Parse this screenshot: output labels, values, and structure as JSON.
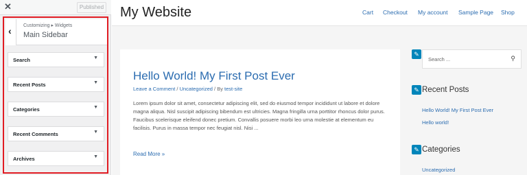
{
  "customizer": {
    "close_glyph": "✕",
    "publish_label": "Published",
    "back_glyph": "‹",
    "breadcrumb": "Customizing ▸ Widgets",
    "panel_title": "Main Sidebar",
    "caret_glyph": "▼",
    "widgets": [
      {
        "label": "Search"
      },
      {
        "label": "Recent Posts"
      },
      {
        "label": "Categories"
      },
      {
        "label": "Recent Comments"
      },
      {
        "label": "Archives"
      }
    ]
  },
  "site": {
    "title": "My Website",
    "nav": [
      "Cart",
      "Checkout",
      "My account",
      "Sample Page",
      "Shop"
    ],
    "post": {
      "title": "Hello World! My First Post Ever",
      "meta_comment": "Leave a Comment",
      "meta_sep1": " / ",
      "meta_category": "Uncategorized",
      "meta_sep2": " / By ",
      "meta_author": "test-site",
      "body": "Lorem ipsum dolor sit amet, consectetur adipiscing elit, sed do eiusmod tempor incididunt ut labore et dolore magna aliqua. Nisl suscipit adipiscing bibendum est ultricies. Magna fringilla urna porttitor rhoncus dolor purus. Faucibus scelerisque eleifend donec pretium. Convallis posuere morbi leo urna molestie at elementum eu facilisis. Purus in massa tempor nec feugiat nisl. Nisi ...",
      "read_more": "Read More »"
    },
    "sidebar": {
      "edit_glyph": "✎",
      "search_placeholder": "Search ...",
      "search_icon_glyph": "⚲",
      "recent_posts_title": "Recent Posts",
      "recent_posts": [
        "Hello World! My First Post Ever",
        "Hello world!"
      ],
      "categories_title": "Categories",
      "categories": [
        "Uncategorized"
      ]
    }
  },
  "colors": {
    "highlight_border": "#e11b22",
    "link": "#2b6cb0",
    "edit_shortcut": "#0085ba"
  }
}
